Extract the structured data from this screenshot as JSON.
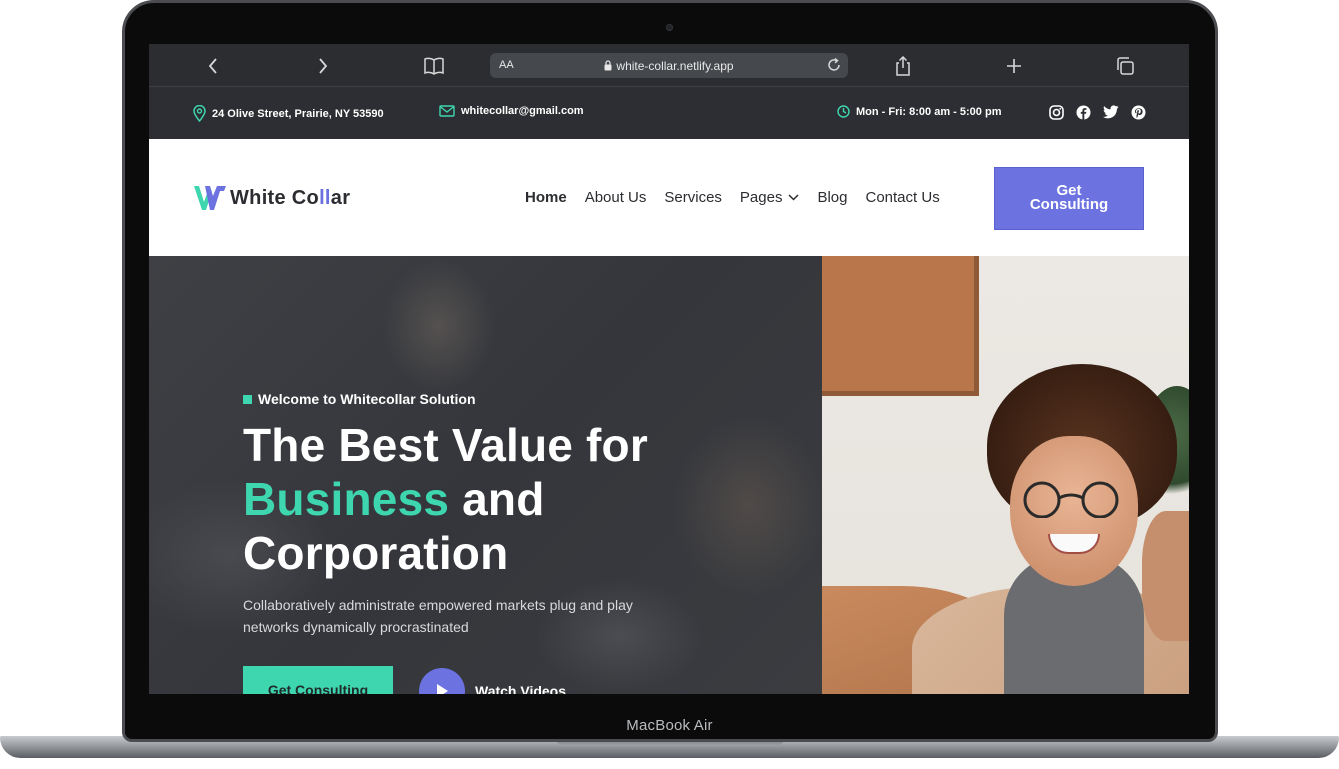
{
  "device": {
    "label": "MacBook Air"
  },
  "browser": {
    "url": "white-collar.netlify.app",
    "aa_label": "AA"
  },
  "topbar": {
    "address": "24 Olive Street, Prairie, NY 53590",
    "email": "whitecollar@gmail.com",
    "hours": "Mon - Fri: 8:00 am - 5:00 pm",
    "social_icons": [
      "instagram-icon",
      "facebook-icon",
      "twitter-icon",
      "pinterest-icon"
    ]
  },
  "brand": {
    "name_part1": "White Co",
    "name_part2": "ll",
    "name_part3": "ar"
  },
  "nav": {
    "items": [
      {
        "label": "Home",
        "active": true
      },
      {
        "label": "About Us"
      },
      {
        "label": "Services"
      },
      {
        "label": "Pages",
        "dropdown": true
      },
      {
        "label": "Blog"
      },
      {
        "label": "Contact Us"
      }
    ],
    "cta_line1": "Get",
    "cta_line2": "Consulting"
  },
  "hero": {
    "eyebrow": "Welcome to Whitecollar Solution",
    "headline_line1": "The Best Value for",
    "headline_green": "Business",
    "headline_line2_rest": " and",
    "headline_line3": "Corporation",
    "subtext": "Collaboratively administrate empowered markets plug and play networks dynamically procrastinated",
    "primary_button": "Get Consulting",
    "video_button": "Watch Videos"
  },
  "colors": {
    "accent_green": "#3ed6ae",
    "accent_purple": "#6c72e0",
    "dark_bar": "#2c2e33"
  }
}
